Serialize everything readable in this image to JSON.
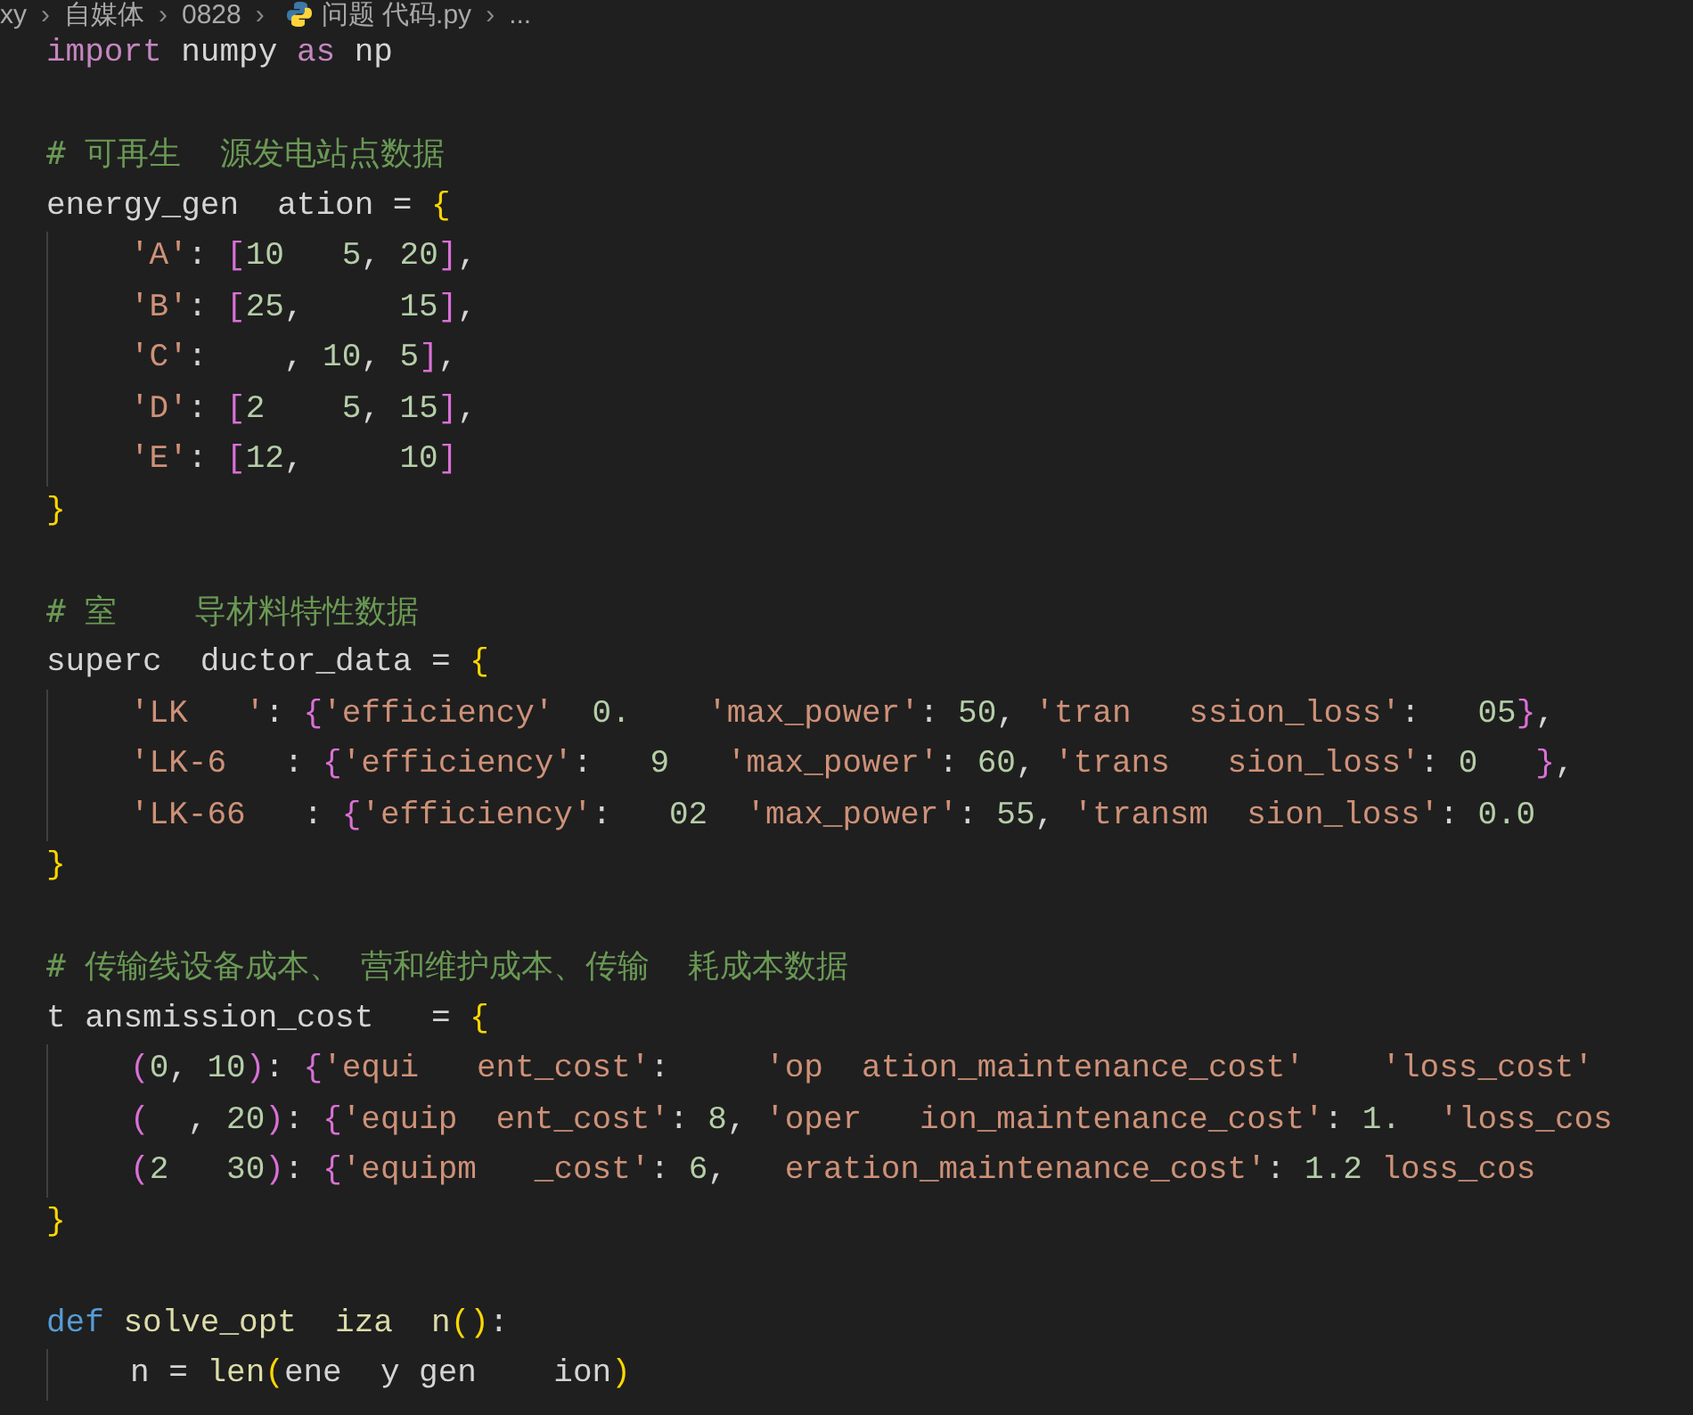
{
  "breadcrumb": [
    {
      "kind": "text",
      "text": "xy"
    },
    {
      "kind": "sep",
      "text": "›"
    },
    {
      "kind": "text",
      "text": "自媒体"
    },
    {
      "kind": "sep",
      "text": "›"
    },
    {
      "kind": "text",
      "text": "0828"
    },
    {
      "kind": "sep",
      "text": "›"
    },
    {
      "kind": "file",
      "text": "问题 代码.py"
    },
    {
      "kind": "sep",
      "text": "›"
    },
    {
      "kind": "text",
      "text": "..."
    }
  ],
  "lines": [
    {
      "indented": false,
      "tokens": [
        {
          "kind": "kw",
          "text": "import"
        },
        {
          "kind": "p",
          "text": " numpy "
        },
        {
          "kind": "kw",
          "text": "as"
        },
        {
          "kind": "p",
          "text": " np"
        }
      ]
    },
    {
      "indented": false
    },
    {
      "indented": false,
      "tokens": [
        {
          "kind": "cm",
          "text": "# 可再生  源发电站点数据"
        }
      ]
    },
    {
      "indented": false,
      "tokens": [
        {
          "kind": "p",
          "text": "energy_gen  ation = "
        },
        {
          "kind": "b1",
          "text": "{"
        }
      ]
    },
    {
      "indented": true,
      "tokens": [
        {
          "kind": "str",
          "text": "'A'"
        },
        {
          "kind": "p",
          "text": ": "
        },
        {
          "kind": "b2",
          "text": "["
        },
        {
          "kind": "num",
          "text": "10   "
        },
        {
          "kind": "num",
          "text": "5"
        },
        {
          "kind": "p",
          "text": ", "
        },
        {
          "kind": "num",
          "text": "20"
        },
        {
          "kind": "b2",
          "text": "]"
        },
        {
          "kind": "p",
          "text": ","
        }
      ]
    },
    {
      "indented": true,
      "tokens": [
        {
          "kind": "str",
          "text": "'B'"
        },
        {
          "kind": "p",
          "text": ": "
        },
        {
          "kind": "b2",
          "text": "["
        },
        {
          "kind": "num",
          "text": "25"
        },
        {
          "kind": "p",
          "text": ",     "
        },
        {
          "kind": "num",
          "text": "15"
        },
        {
          "kind": "b2",
          "text": "]"
        },
        {
          "kind": "p",
          "text": ","
        }
      ]
    },
    {
      "indented": true,
      "tokens": [
        {
          "kind": "str",
          "text": "'C'"
        },
        {
          "kind": "p",
          "text": ":    , "
        },
        {
          "kind": "num",
          "text": "10"
        },
        {
          "kind": "p",
          "text": ", "
        },
        {
          "kind": "num",
          "text": "5"
        },
        {
          "kind": "b2",
          "text": "]"
        },
        {
          "kind": "p",
          "text": ","
        }
      ]
    },
    {
      "indented": true,
      "tokens": [
        {
          "kind": "str",
          "text": "'D'"
        },
        {
          "kind": "p",
          "text": ": "
        },
        {
          "kind": "b2",
          "text": "["
        },
        {
          "kind": "num",
          "text": "2    "
        },
        {
          "kind": "num",
          "text": "5"
        },
        {
          "kind": "p",
          "text": ", "
        },
        {
          "kind": "num",
          "text": "15"
        },
        {
          "kind": "b2",
          "text": "]"
        },
        {
          "kind": "p",
          "text": ","
        }
      ]
    },
    {
      "indented": true,
      "tokens": [
        {
          "kind": "str",
          "text": "'E'"
        },
        {
          "kind": "p",
          "text": ": "
        },
        {
          "kind": "b2",
          "text": "["
        },
        {
          "kind": "num",
          "text": "12"
        },
        {
          "kind": "p",
          "text": ",     "
        },
        {
          "kind": "num",
          "text": "10"
        },
        {
          "kind": "b2",
          "text": "]"
        }
      ]
    },
    {
      "indented": false,
      "tokens": [
        {
          "kind": "b1",
          "text": "}"
        }
      ]
    },
    {
      "indented": false
    },
    {
      "indented": false,
      "tokens": [
        {
          "kind": "cm",
          "text": "# 室    导材料特性数据"
        }
      ]
    },
    {
      "indented": false,
      "tokens": [
        {
          "kind": "p",
          "text": "superc  ductor_data = "
        },
        {
          "kind": "b1",
          "text": "{"
        }
      ]
    },
    {
      "indented": true,
      "tokens": [
        {
          "kind": "str",
          "text": "'LK   '"
        },
        {
          "kind": "p",
          "text": ": "
        },
        {
          "kind": "b2",
          "text": "{"
        },
        {
          "kind": "str",
          "text": "'efficiency'  "
        },
        {
          "kind": "num",
          "text": "0.    "
        },
        {
          "kind": "str",
          "text": "'max_power'"
        },
        {
          "kind": "p",
          "text": ": "
        },
        {
          "kind": "num",
          "text": "50"
        },
        {
          "kind": "p",
          "text": ", "
        },
        {
          "kind": "str",
          "text": "'tran   ssion_loss'"
        },
        {
          "kind": "p",
          "text": ":   "
        },
        {
          "kind": "num",
          "text": "05"
        },
        {
          "kind": "b2",
          "text": "}"
        },
        {
          "kind": "p",
          "text": ","
        }
      ]
    },
    {
      "indented": true,
      "tokens": [
        {
          "kind": "str",
          "text": "'LK-6"
        },
        {
          "kind": "p",
          "text": "   : "
        },
        {
          "kind": "b2",
          "text": "{"
        },
        {
          "kind": "str",
          "text": "'efficiency'"
        },
        {
          "kind": "p",
          "text": ":   "
        },
        {
          "kind": "num",
          "text": "9   "
        },
        {
          "kind": "str",
          "text": "'max_power'"
        },
        {
          "kind": "p",
          "text": ": "
        },
        {
          "kind": "num",
          "text": "60"
        },
        {
          "kind": "p",
          "text": ", "
        },
        {
          "kind": "str",
          "text": "'trans   sion_loss'"
        },
        {
          "kind": "p",
          "text": ": "
        },
        {
          "kind": "num",
          "text": "0   "
        },
        {
          "kind": "b2",
          "text": "}"
        },
        {
          "kind": "p",
          "text": ","
        }
      ]
    },
    {
      "indented": true,
      "tokens": [
        {
          "kind": "str",
          "text": "'LK-66"
        },
        {
          "kind": "p",
          "text": "   : "
        },
        {
          "kind": "b2",
          "text": "{"
        },
        {
          "kind": "str",
          "text": "'efficiency'"
        },
        {
          "kind": "p",
          "text": ":   "
        },
        {
          "kind": "num",
          "text": "02  "
        },
        {
          "kind": "str",
          "text": "'max_power'"
        },
        {
          "kind": "p",
          "text": ": "
        },
        {
          "kind": "num",
          "text": "55"
        },
        {
          "kind": "p",
          "text": ", "
        },
        {
          "kind": "str",
          "text": "'transm  sion_loss'"
        },
        {
          "kind": "p",
          "text": ": "
        },
        {
          "kind": "num",
          "text": "0.0"
        }
      ]
    },
    {
      "indented": false,
      "tokens": [
        {
          "kind": "b1",
          "text": "}"
        }
      ]
    },
    {
      "indented": false
    },
    {
      "indented": false,
      "tokens": [
        {
          "kind": "cm",
          "text": "# 传输线设备成本、 营和维护成本、传输  耗成本数据"
        }
      ]
    },
    {
      "indented": false,
      "tokens": [
        {
          "kind": "p",
          "text": "t ansmission_cost   = "
        },
        {
          "kind": "b1",
          "text": "{"
        }
      ]
    },
    {
      "indented": true,
      "tokens": [
        {
          "kind": "b2",
          "text": "("
        },
        {
          "kind": "num",
          "text": "0"
        },
        {
          "kind": "p",
          "text": ", "
        },
        {
          "kind": "num",
          "text": "10"
        },
        {
          "kind": "b2",
          "text": ")"
        },
        {
          "kind": "p",
          "text": ": "
        },
        {
          "kind": "b2",
          "text": "{"
        },
        {
          "kind": "str",
          "text": "'equi   ent_cost'"
        },
        {
          "kind": "p",
          "text": ":     "
        },
        {
          "kind": "str",
          "text": "'op  ation_maintenance_cost'    "
        },
        {
          "kind": "str",
          "text": "'loss_cost'"
        }
      ]
    },
    {
      "indented": true,
      "tokens": [
        {
          "kind": "b2",
          "text": "("
        },
        {
          "kind": "p",
          "text": "  , "
        },
        {
          "kind": "num",
          "text": "20"
        },
        {
          "kind": "b2",
          "text": ")"
        },
        {
          "kind": "p",
          "text": ": "
        },
        {
          "kind": "b2",
          "text": "{"
        },
        {
          "kind": "str",
          "text": "'equip  ent_cost'"
        },
        {
          "kind": "p",
          "text": ": "
        },
        {
          "kind": "num",
          "text": "8"
        },
        {
          "kind": "p",
          "text": ", "
        },
        {
          "kind": "str",
          "text": "'oper   ion_maintenance_cost'"
        },
        {
          "kind": "p",
          "text": ": "
        },
        {
          "kind": "num",
          "text": "1.  "
        },
        {
          "kind": "str",
          "text": "'loss_cos"
        }
      ]
    },
    {
      "indented": true,
      "tokens": [
        {
          "kind": "b2",
          "text": "("
        },
        {
          "kind": "num",
          "text": "2   "
        },
        {
          "kind": "num",
          "text": "30"
        },
        {
          "kind": "b2",
          "text": ")"
        },
        {
          "kind": "p",
          "text": ": "
        },
        {
          "kind": "b2",
          "text": "{"
        },
        {
          "kind": "str",
          "text": "'equipm   _cost'"
        },
        {
          "kind": "p",
          "text": ": "
        },
        {
          "kind": "num",
          "text": "6"
        },
        {
          "kind": "p",
          "text": ",   "
        },
        {
          "kind": "str",
          "text": "eration_maintenance_cost'"
        },
        {
          "kind": "p",
          "text": ": "
        },
        {
          "kind": "num",
          "text": "1.2 "
        },
        {
          "kind": "str",
          "text": "loss_cos"
        }
      ]
    },
    {
      "indented": false,
      "tokens": [
        {
          "kind": "b1",
          "text": "}"
        }
      ]
    },
    {
      "indented": false
    },
    {
      "indented": false,
      "tokens": [
        {
          "kind": "def",
          "text": "def "
        },
        {
          "kind": "fn",
          "text": "solve_opt  iza  n"
        },
        {
          "kind": "b1",
          "text": "()"
        },
        {
          "kind": "p",
          "text": ":"
        }
      ]
    },
    {
      "indented": true,
      "tokens": [
        {
          "kind": "p",
          "text": "n = "
        },
        {
          "kind": "fn",
          "text": "len"
        },
        {
          "kind": "b1",
          "text": "("
        },
        {
          "kind": "p",
          "text": "ene  y gen    ion"
        },
        {
          "kind": "b1",
          "text": ")"
        }
      ]
    }
  ]
}
